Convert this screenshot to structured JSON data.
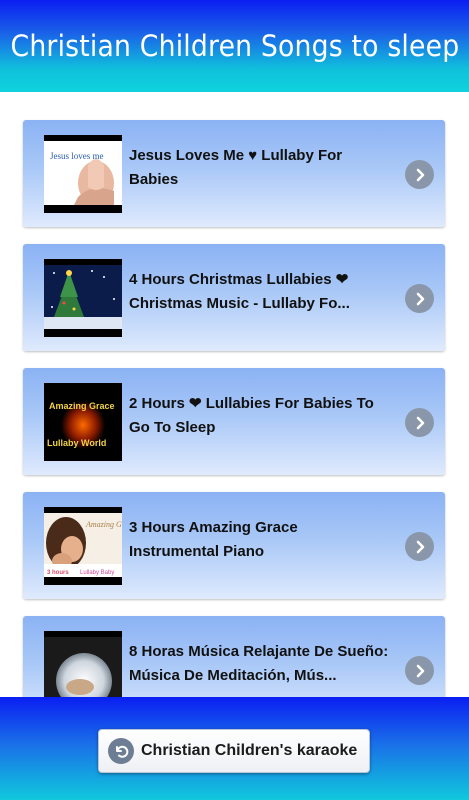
{
  "header": {
    "title": "Christian Children Songs to sleep"
  },
  "items": [
    {
      "title": "Jesus Loves Me ♥ Lullaby For Babies",
      "thumb_icon": "jesus-loves-me-thumbnail",
      "thumb_text": "Jesus loves me"
    },
    {
      "title": "4 Hours Christmas Lullabies ❤ Christmas Music - Lullaby Fo...",
      "thumb_icon": "christmas-tree-thumbnail"
    },
    {
      "title": "2 Hours ❤ Lullabies For Babies To Go To Sleep",
      "thumb_icon": "amazing-grace-lullaby-world-thumbnail",
      "thumb_text_top": "Amazing Grace",
      "thumb_text_bottom": "Lullaby World"
    },
    {
      "title": "3 Hours Amazing Grace Instrumental Piano",
      "thumb_icon": "mother-baby-thumbnail",
      "thumb_text_top": "Amazing Grace",
      "thumb_text_left": "3 hours",
      "thumb_text_right": "Lullaby Baby"
    },
    {
      "title": "8 Horas Música Relajante De Sueño: Música De Meditación, Mús...",
      "thumb_icon": "moon-baby-thumbnail"
    }
  ],
  "footer": {
    "karaoke_label": "Christian Children's karaoke"
  },
  "colors": {
    "header_top": "#0a1ef2",
    "header_bottom": "#0fd3dc",
    "card_top": "#8bb2f4",
    "card_bottom": "#dfeafd",
    "chevron": "#8a97ab"
  }
}
